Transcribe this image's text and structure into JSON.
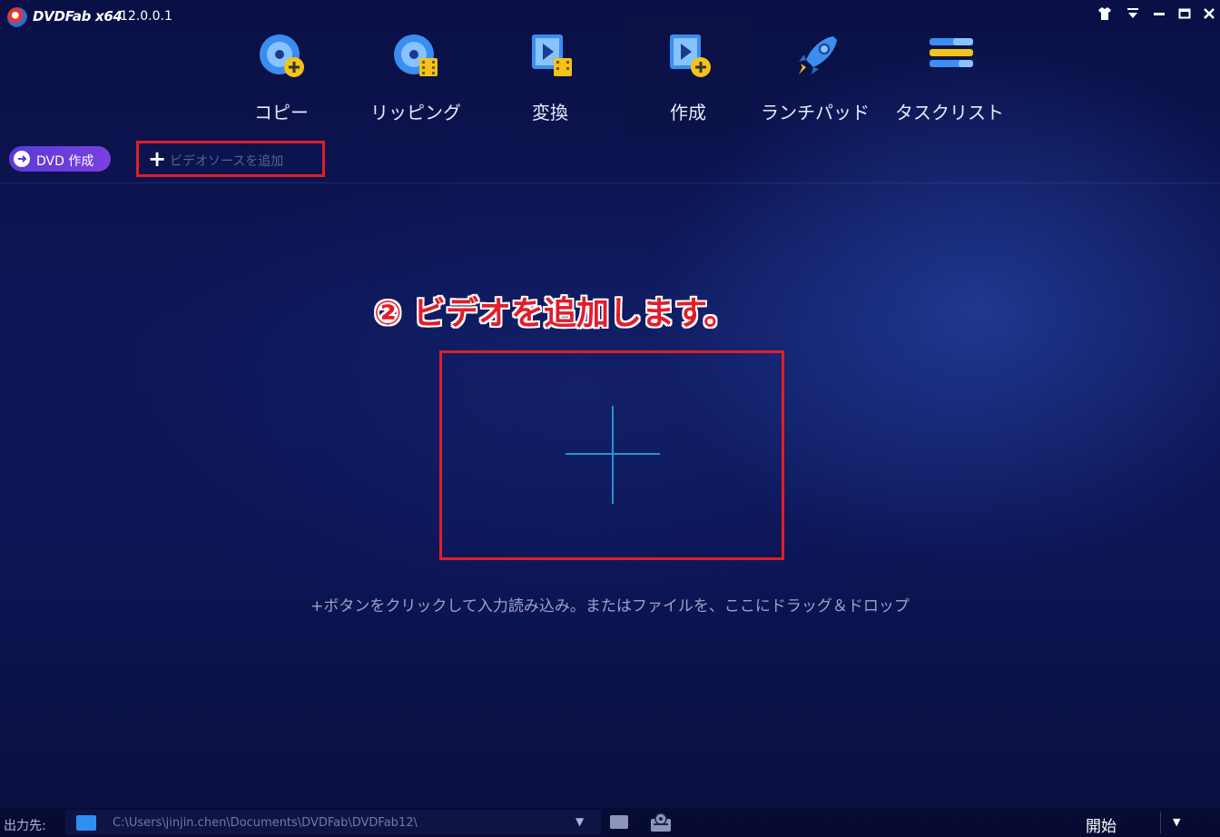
{
  "app": {
    "brand": "DVDFab x64",
    "version": "12.0.0.1"
  },
  "window_controls": {
    "skin_icon": "shirt-icon",
    "menu_icon": "menu-down-icon",
    "minimize_icon": "minimize-icon",
    "maximize_icon": "maximize-icon",
    "close_icon": "close-icon"
  },
  "nav": {
    "items": [
      {
        "label": "コピー",
        "icon": "disc-copy-icon"
      },
      {
        "label": "リッピング",
        "icon": "disc-ripper-icon"
      },
      {
        "label": "変換",
        "icon": "video-converter-icon"
      },
      {
        "label": "作成",
        "icon": "video-creator-icon",
        "active": true
      },
      {
        "label": "ランチパッド",
        "icon": "rocket-icon"
      },
      {
        "label": "タスクリスト",
        "icon": "task-list-icon"
      }
    ]
  },
  "subbar": {
    "mode_label": "DVD 作成",
    "add_source_label": "ビデオソースを追加"
  },
  "annotation": {
    "text": "② ビデオを追加します。",
    "color": "#e01e2a"
  },
  "main": {
    "hint": "+ボタンをクリックして入力読み込み。またはファイルを、ここにドラッグ＆ドロップ"
  },
  "bottombar": {
    "output_label": "出力先:",
    "output_path": "C:\\Users\\jinjin.chen\\Documents\\DVDFab\\DVDFab12\\",
    "start_label": "開始"
  },
  "colors": {
    "accent_red": "#e01e2a",
    "mode_purple": "#6a3ddc",
    "plus_blue": "#2a90d6"
  }
}
